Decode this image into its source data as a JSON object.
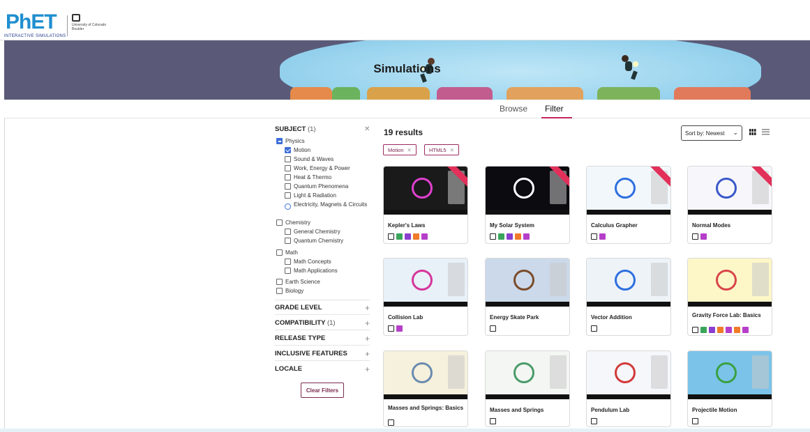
{
  "header": {
    "logo_text": "PhET",
    "logo_subtitle": "INTERACTIVE SIMULATIONS",
    "partner_text": "University of Colorado Boulder"
  },
  "banner": {
    "title": "Simulations"
  },
  "tabs": [
    {
      "label": "Browse",
      "active": false
    },
    {
      "label": "Filter",
      "active": true
    }
  ],
  "filters": {
    "subject": {
      "title": "SUBJECT",
      "count": "(1)",
      "groups": [
        {
          "label": "Physics",
          "state": "partial",
          "children": [
            {
              "label": "Motion",
              "checked": true
            },
            {
              "label": "Sound & Waves",
              "checked": false
            },
            {
              "label": "Work, Energy & Power",
              "checked": false
            },
            {
              "label": "Heat & Thermo",
              "checked": false
            },
            {
              "label": "Quantum Phenomena",
              "checked": false
            },
            {
              "label": "Light & Radiation",
              "checked": false
            },
            {
              "label": "Electricity, Magnets & Circuits",
              "checked": false
            }
          ]
        },
        {
          "label": "Chemistry",
          "state": "unchecked",
          "children": [
            {
              "label": "General Chemistry",
              "checked": false
            },
            {
              "label": "Quantum Chemistry",
              "checked": false
            }
          ]
        },
        {
          "label": "Math",
          "state": "unchecked",
          "children": [
            {
              "label": "Math Concepts",
              "checked": false
            },
            {
              "label": "Math Applications",
              "checked": false
            }
          ]
        },
        {
          "label": "Earth Science",
          "state": "unchecked",
          "children": []
        },
        {
          "label": "Biology",
          "state": "unchecked",
          "children": []
        }
      ]
    },
    "sections": [
      {
        "label": "GRADE LEVEL",
        "count": ""
      },
      {
        "label": "COMPATIBILITY",
        "count": "(1)"
      },
      {
        "label": "RELEASE TYPE",
        "count": ""
      },
      {
        "label": "INCLUSIVE FEATURES",
        "count": ""
      },
      {
        "label": "LOCALE",
        "count": ""
      }
    ],
    "clear_label": "Clear Filters"
  },
  "results": {
    "count_label": "19 results",
    "active_chips": [
      "Motion",
      "HTML5"
    ],
    "sort_label": "Sort by: Newest"
  },
  "cards": [
    {
      "title": "Kepler's Laws",
      "new": true,
      "thumb": "#1a1a1a",
      "accent": "#e040d0",
      "badges": [
        "html",
        "green",
        "purple",
        "orange",
        "violet"
      ]
    },
    {
      "title": "My Solar System",
      "new": true,
      "thumb": "#0b0b10",
      "accent": "#ffffff",
      "badges": [
        "html",
        "green",
        "purple",
        "orange",
        "violet"
      ]
    },
    {
      "title": "Calculus Grapher",
      "new": true,
      "thumb": "#f2f7fb",
      "accent": "#2d6fe0",
      "badges": [
        "html",
        "violet"
      ]
    },
    {
      "title": "Normal Modes",
      "new": true,
      "thumb": "#f7f7fb",
      "accent": "#3a58c9",
      "badges": [
        "html",
        "violet"
      ]
    },
    {
      "title": "Collision Lab",
      "new": false,
      "thumb": "#e8f0f8",
      "accent": "#d6349a",
      "badges": [
        "html",
        "violet"
      ]
    },
    {
      "title": "Energy Skate Park",
      "new": false,
      "thumb": "#cbd9ea",
      "accent": "#7b4b2a",
      "badges": [
        "html"
      ]
    },
    {
      "title": "Vector Addition",
      "new": false,
      "thumb": "#eef3f8",
      "accent": "#2d6fe0",
      "badges": [
        "html"
      ]
    },
    {
      "title": "Gravity Force Lab: Basics",
      "new": false,
      "thumb": "#fdf7c8",
      "accent": "#d8454a",
      "badges": [
        "html",
        "green",
        "purple",
        "orange",
        "violet",
        "orange",
        "violet"
      ]
    },
    {
      "title": "Masses and Springs: Basics",
      "new": false,
      "thumb": "#f6f1dc",
      "accent": "#6a8bb0",
      "badges": [
        "html"
      ]
    },
    {
      "title": "Masses and Springs",
      "new": false,
      "thumb": "#f3f6f3",
      "accent": "#4a9b6a",
      "badges": [
        "html"
      ]
    },
    {
      "title": "Pendulum Lab",
      "new": false,
      "thumb": "#f5f7fb",
      "accent": "#d23a3a",
      "badges": [
        "html"
      ]
    },
    {
      "title": "Projectile Motion",
      "new": false,
      "thumb": "#7bc3e8",
      "accent": "#3aa040",
      "badges": [
        "html"
      ]
    }
  ]
}
